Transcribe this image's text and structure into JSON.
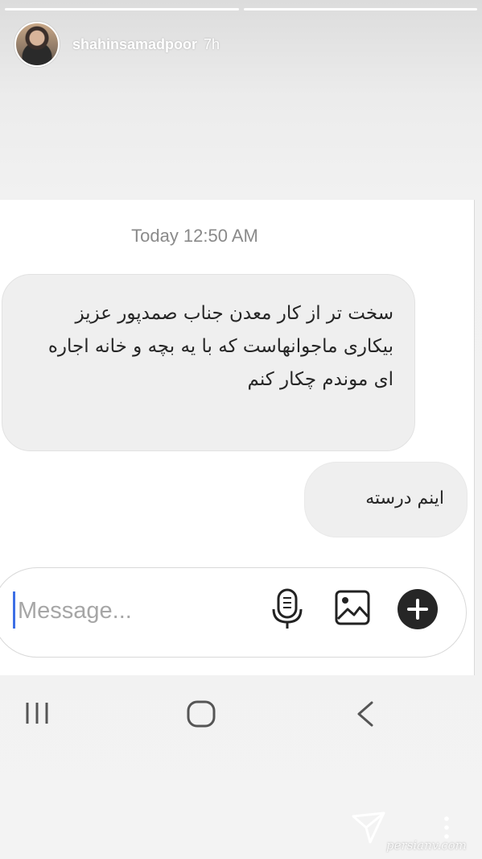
{
  "story": {
    "progress_segments": 2,
    "username": "shahinsamadpoor",
    "time": "7h"
  },
  "chat": {
    "timestamp": "Today 12:50 AM",
    "received_message": "سخت تر از کار معدن جناب صمدپور عزیز بیکاری ماجوانهاست که با یه بچه و خانه اجاره ای موندم چکار کنم",
    "sent_message": "اینم درسته"
  },
  "composer": {
    "placeholder": "Message...",
    "icons": [
      "microphone-icon",
      "gallery-icon",
      "plus-icon"
    ]
  },
  "navbar": {
    "icons": [
      "recent-apps-icon",
      "home-icon",
      "back-icon"
    ]
  },
  "footer": {
    "icons": [
      "send-icon",
      "more-options-icon"
    ],
    "watermark": "persianv.com"
  },
  "colors": {
    "caret": "#3d6fe5",
    "bubble": "#efefef",
    "timestamp": "#8a8a8a",
    "plus_button": "#262626"
  }
}
